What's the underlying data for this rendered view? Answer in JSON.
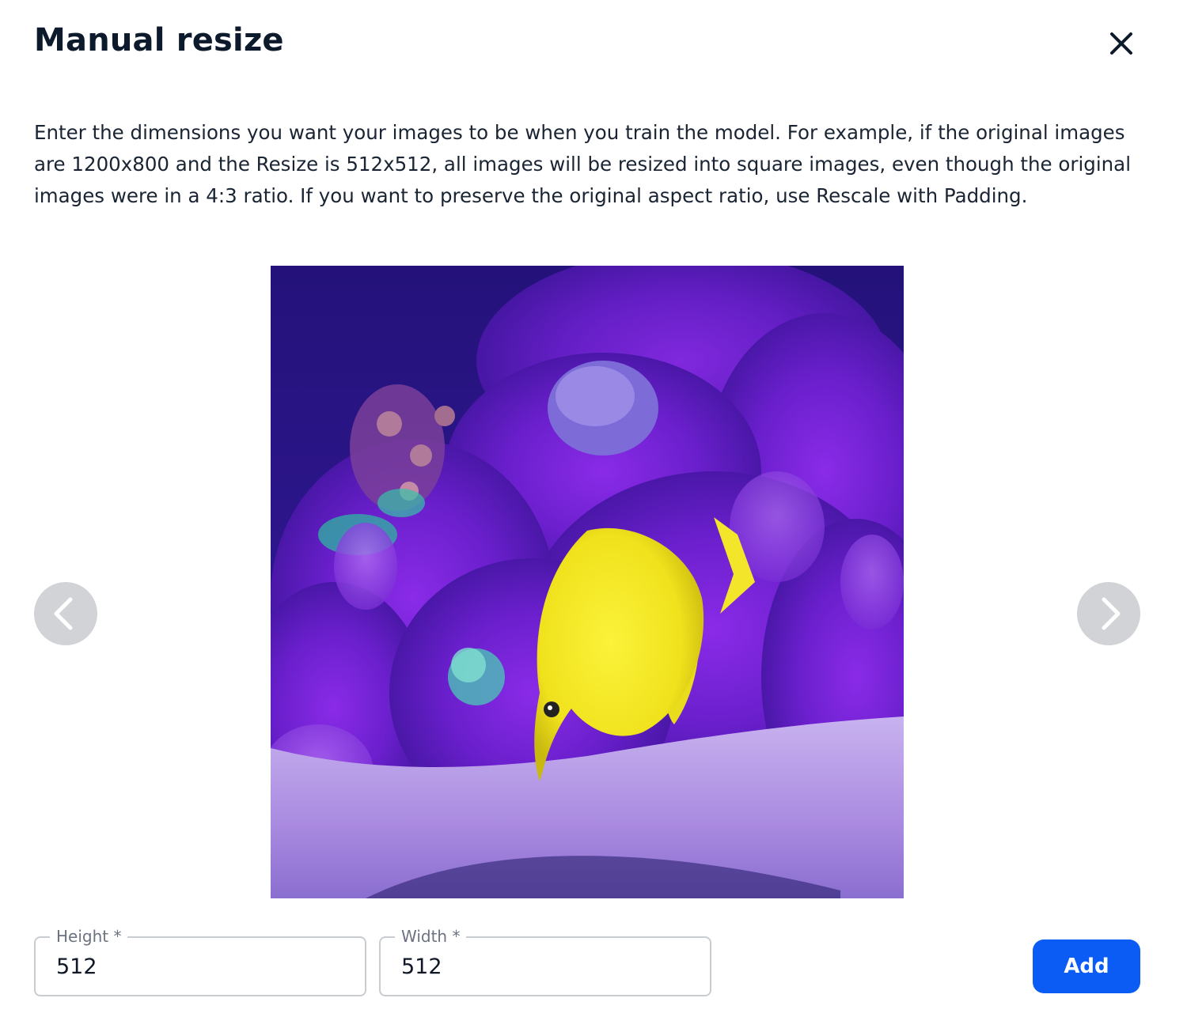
{
  "dialog": {
    "title": "Manual resize",
    "close_icon": "close-icon",
    "description": "Enter the dimensions you want your images to be when you train the model. For example, if the original images are 1200x800 and the Resize is 512x512, all images will be resized into square images, even though the original images were in a 4:3 ratio. If you want to preserve the original aspect ratio, use Rescale with Padding."
  },
  "preview": {
    "image": "yellow tang fish swimming over purple coral reef and gravel",
    "prev_icon": "chevron-left-icon",
    "next_icon": "chevron-right-icon"
  },
  "form": {
    "height_label": "Height *",
    "height_value": "512",
    "width_label": "Width *",
    "width_value": "512",
    "add_label": "Add"
  },
  "colors": {
    "accent": "#0a5cf5",
    "title": "#0c1a2b",
    "nav_button_bg": "#d1d3d6",
    "field_border": "#c9ccd1"
  }
}
